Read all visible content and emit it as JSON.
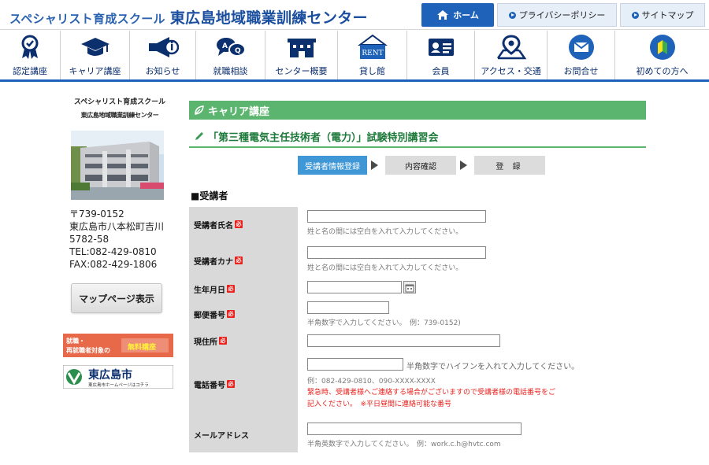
{
  "header": {
    "school_name": "スペシャリスト育成スクール",
    "center_name": "東広島地域職業訓練センター",
    "home_label": "ホーム",
    "privacy_label": "プライバシーポリシー",
    "sitemap_label": "サイトマップ",
    "accent_color": "#1e63b9"
  },
  "nav": {
    "items": [
      {
        "label": "認定講座",
        "icon": "ribbon-badge-icon"
      },
      {
        "label": "キャリア講座",
        "icon": "graduation-cap-icon"
      },
      {
        "label": "お知らせ",
        "icon": "megaphone-icon"
      },
      {
        "label": "就職相談",
        "icon": "chat-bubbles-icon"
      },
      {
        "label": "センター概要",
        "icon": "building-icon"
      },
      {
        "label": "貸し館",
        "icon": "rent-sign-icon",
        "icon_text": "RENT"
      },
      {
        "label": "会員",
        "icon": "member-card-icon"
      },
      {
        "label": "アクセス・交通",
        "icon": "map-pin-icon"
      },
      {
        "label": "お問合せ",
        "icon": "envelope-icon"
      },
      {
        "label": "初めての方へ",
        "icon": "beginner-mark-icon"
      }
    ]
  },
  "sidebar": {
    "school_name": "スペシャリスト育成スクール",
    "center_name": "東広島地域職業訓練センター",
    "address_lines": [
      "〒739-0152",
      "東広島市八本松町吉川",
      "5782-58",
      "TEL:082-429-0810",
      "FAX:082-429-1806"
    ],
    "map_button": "マップページ表示",
    "banner1": {
      "line1": "就職・",
      "line2": "再就職者対象の",
      "highlight": "無料講座"
    },
    "banner2": {
      "title": "東広島市",
      "subtitle": "東広島市ホームページはコチラ"
    }
  },
  "main": {
    "section_heading": "キャリア講座",
    "course_title": "「第三種電気主任技術者（電力）」試験特別講習会",
    "steps": [
      "受講者情報登録",
      "内容確認",
      "登 録"
    ],
    "section_label": "■受講者",
    "required_mark": "必",
    "form": {
      "name": {
        "label": "受講者氏名",
        "value": "",
        "hint": "姓と名の間には空白を入れて入力してください。"
      },
      "kana": {
        "label": "受講者カナ",
        "value": "",
        "hint": "姓と名の間には空白を入れて入力してください。"
      },
      "birthdate": {
        "label": "生年月日",
        "value": ""
      },
      "postal": {
        "label": "郵便番号",
        "value": "",
        "hint": "半角数字で入力してください。　例：739-0152)"
      },
      "address": {
        "label": "現住所",
        "value": ""
      },
      "phone": {
        "label": "電話番号",
        "value": "",
        "inline_hint": "半角数字でハイフンを入れて入力してください。",
        "example": "例：082-429-0810、090-XXXX-XXXX",
        "warning_line1": "緊急時、受講者様へご連絡する場合がございますので受講者様の電話番号をご",
        "warning_line2": "記入ください。　※平日昼間に連絡可能な番号"
      },
      "email": {
        "label": "メールアドレス",
        "value": "",
        "hint": "半角英数字で入力してください。　例：work.c.h@hvtc.com"
      }
    }
  }
}
